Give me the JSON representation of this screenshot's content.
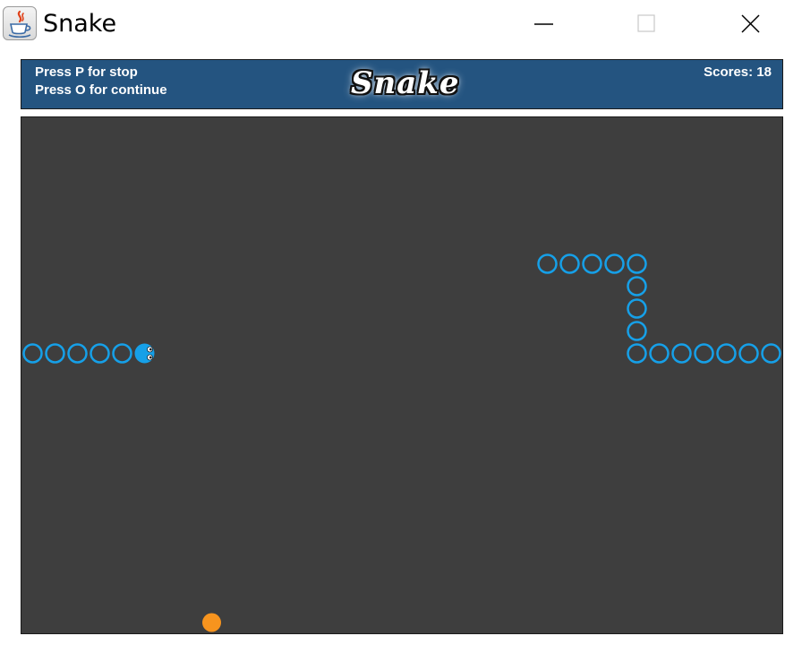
{
  "window": {
    "title": "Snake",
    "icon": "java-coffee-cup-icon",
    "controls": [
      "minimize-icon",
      "maximize-icon",
      "close-icon"
    ]
  },
  "header": {
    "hint_stop": "Press P for stop",
    "hint_continue": "Press O for continue",
    "logo": "Snake",
    "score_label": "Scores:",
    "score_value": 18,
    "score_text": "Scores: 18"
  },
  "game": {
    "grid_columns": 34,
    "grid_rows": 23,
    "snake_length": 6,
    "snake_head": {
      "col": 5,
      "row": 10
    },
    "snake_body": [
      {
        "col": 4,
        "row": 10
      },
      {
        "col": 3,
        "row": 10
      },
      {
        "col": 2,
        "row": 10
      },
      {
        "col": 1,
        "row": 10
      },
      {
        "col": 0,
        "row": 10
      }
    ],
    "snake_direction": "right",
    "wall_cells": [
      {
        "col": 23,
        "row": 6
      },
      {
        "col": 24,
        "row": 6
      },
      {
        "col": 25,
        "row": 6
      },
      {
        "col": 26,
        "row": 6
      },
      {
        "col": 27,
        "row": 6
      },
      {
        "col": 27,
        "row": 7
      },
      {
        "col": 27,
        "row": 8
      },
      {
        "col": 27,
        "row": 9
      },
      {
        "col": 27,
        "row": 10
      },
      {
        "col": 28,
        "row": 10
      },
      {
        "col": 29,
        "row": 10
      },
      {
        "col": 30,
        "row": 10
      },
      {
        "col": 31,
        "row": 10
      },
      {
        "col": 32,
        "row": 10
      },
      {
        "col": 33,
        "row": 10
      }
    ],
    "food": {
      "col": 8,
      "row": 22
    },
    "colors": {
      "header_bg": "#245480",
      "board_bg": "#3e3e3e",
      "snake": "#16a0e8",
      "food": "#f7941e"
    }
  }
}
